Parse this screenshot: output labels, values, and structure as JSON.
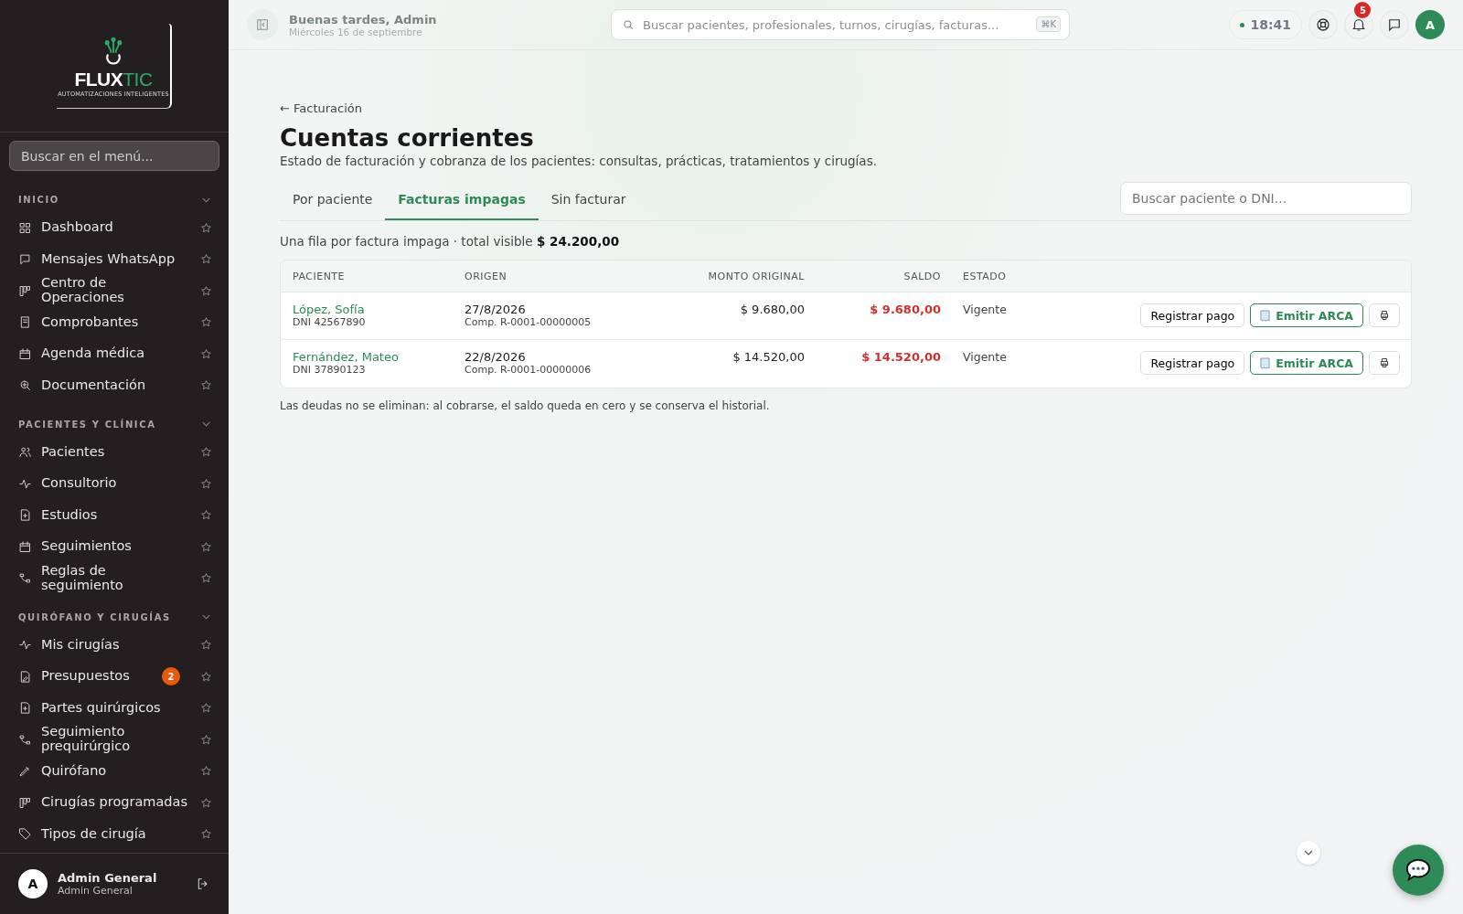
{
  "logo": {
    "word_a": "FLUX",
    "word_b": "TIC",
    "tagline": "AUTOMATIZACIONES INTELIGENTES"
  },
  "sidebar": {
    "search": {
      "placeholder": "Buscar en el menú..."
    },
    "sections": [
      {
        "title": "INICIO",
        "expanded": true,
        "items": [
          {
            "label": "Dashboard",
            "starred": false
          },
          {
            "label": "Mensajes WhatsApp",
            "starred": false
          },
          {
            "label": "Centro de Operaciones",
            "starred": false
          },
          {
            "label": "Comprobantes",
            "starred": false
          },
          {
            "label": "Agenda médica",
            "starred": false
          },
          {
            "label": "Documentación",
            "starred": false
          }
        ]
      },
      {
        "title": "PACIENTES Y CLÍNICA",
        "expanded": true,
        "items": [
          {
            "label": "Pacientes",
            "starred": false
          },
          {
            "label": "Consultorio",
            "starred": false
          },
          {
            "label": "Estudios",
            "starred": false
          },
          {
            "label": "Seguimientos",
            "starred": false
          },
          {
            "label": "Reglas de seguimiento",
            "starred": false
          }
        ]
      },
      {
        "title": "QUIRÓFANO Y CIRUGÍAS",
        "expanded": true,
        "items": [
          {
            "label": "Mis cirugías",
            "starred": false
          },
          {
            "label": "Presupuestos",
            "starred": false,
            "badge": "2"
          },
          {
            "label": "Partes quirúrgicos",
            "starred": false
          },
          {
            "label": "Seguimiento prequirúrgico",
            "starred": false
          },
          {
            "label": "Quirófano",
            "starred": false
          },
          {
            "label": "Cirugías programadas",
            "starred": false
          },
          {
            "label": "Tipos de cirugía",
            "starred": false
          }
        ]
      }
    ],
    "user": {
      "avatar": "A",
      "name": "Admin General",
      "role": "Admin General"
    }
  },
  "topbar": {
    "greeting": "Buenas tardes, Admin",
    "date": "Miércoles 16 de septiembre",
    "search": {
      "placeholder": "Buscar pacientes, profesionales, turnos, cirugías, facturas...",
      "shortcut": "⌘K"
    },
    "time": "18:41",
    "notifications": "5",
    "avatar": "A"
  },
  "page": {
    "back": "← Facturación",
    "title": "Cuentas corrientes",
    "subtitle": "Estado de facturación y cobranza de los pacientes: consultas, prácticas, tratamientos y cirugías.",
    "tabs": [
      {
        "label": "Por paciente",
        "selected": false
      },
      {
        "label": "Facturas impagas",
        "selected": true
      },
      {
        "label": "Sin facturar",
        "selected": false
      }
    ],
    "search": {
      "placeholder": "Buscar paciente o DNI..."
    },
    "summary": "Una fila por factura impaga · total visible **$ 24.200,00**",
    "table": {
      "columns": [
        "PACIENTE",
        "ORIGEN",
        "MONTO ORIGINAL",
        "SALDO",
        "ESTADO"
      ],
      "rows": [
        {
          "patient": "López, Sofía",
          "dni": "DNI 42567890",
          "date": "27/8/2026",
          "voucher": "Comp. R-0001-00000005",
          "amount": "$ 9.680,00",
          "balance": "$ 9.680,00",
          "status": "Vigente",
          "pay": "Registrar pago",
          "emit": "Emitir ARCA"
        },
        {
          "patient": "Fernández, Mateo",
          "dni": "DNI 37890123",
          "date": "22/8/2026",
          "voucher": "Comp. R-0001-00000006",
          "amount": "$ 14.520,00",
          "balance": "$ 14.520,00",
          "status": "Vigente",
          "pay": "Registrar pago",
          "emit": "Emitir ARCA"
        }
      ]
    },
    "note": "Las deudas no se eliminan: al cobrarse, el saldo queda en cero y se conserva el historial."
  }
}
